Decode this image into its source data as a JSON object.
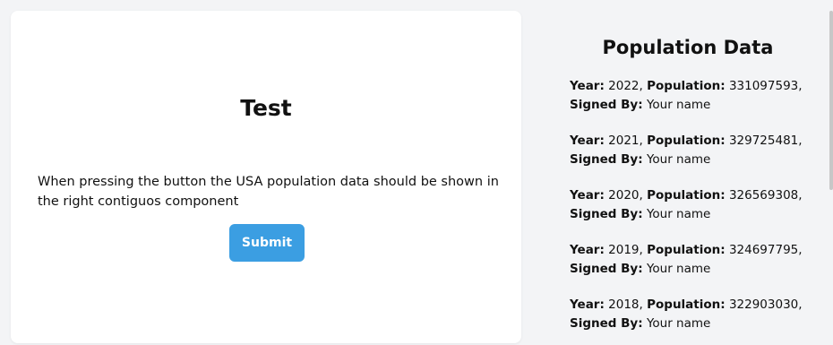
{
  "left": {
    "title": "Test",
    "description": "When pressing the button the USA population data should be shown in the right contiguos component",
    "submit_label": "Submit"
  },
  "right": {
    "title": "Population Data",
    "labels": {
      "year": "Year:",
      "population": "Population:",
      "signed_by": "Signed By:"
    },
    "records": [
      {
        "year": "2022",
        "population": "331097593",
        "signed_by": "Your name"
      },
      {
        "year": "2021",
        "population": "329725481",
        "signed_by": "Your name"
      },
      {
        "year": "2020",
        "population": "326569308",
        "signed_by": "Your name"
      },
      {
        "year": "2019",
        "population": "324697795",
        "signed_by": "Your name"
      },
      {
        "year": "2018",
        "population": "322903030",
        "signed_by": "Your name"
      }
    ]
  },
  "colors": {
    "accent": "#3b9ee2",
    "background": "#f3f4f6",
    "card": "#ffffff"
  }
}
